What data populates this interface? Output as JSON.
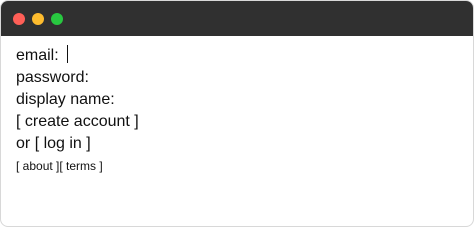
{
  "window": {
    "colors": {
      "titlebar": "#303030",
      "close": "#ff5f57",
      "minimize": "#febc2e",
      "maximize": "#28c840"
    }
  },
  "form": {
    "email_label": "email:",
    "email_value": "",
    "password_label": "password:",
    "display_name_label": "display name:",
    "create_account": "[ create account ]",
    "or_text": "or",
    "log_in": "[ log in ]"
  },
  "footer": {
    "about": "[ about ]",
    "terms": "[ terms ]"
  }
}
